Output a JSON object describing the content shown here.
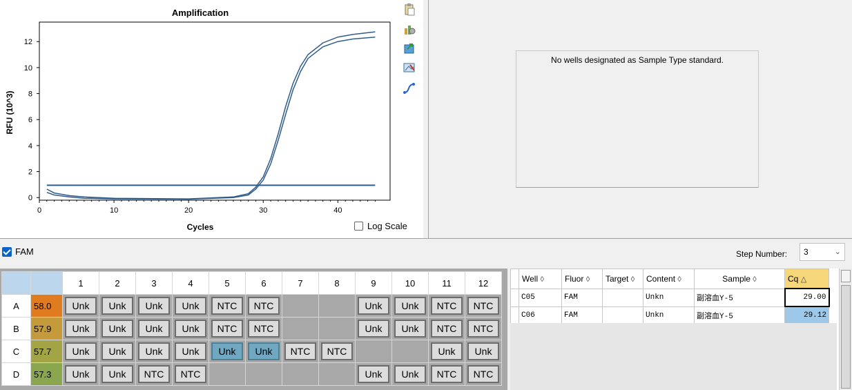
{
  "chart_data": {
    "type": "line",
    "title": "Amplification",
    "xlabel": "Cycles",
    "ylabel": "RFU (10^3)",
    "xlim": [
      0,
      47
    ],
    "ylim": [
      -0.2,
      13.5
    ],
    "xticks": [
      0,
      10,
      20,
      30,
      40
    ],
    "yticks": [
      0,
      2,
      4,
      6,
      8,
      10,
      12
    ],
    "grid": true,
    "threshold": 0.95,
    "series": [
      {
        "values": [
          [
            1,
            0.65
          ],
          [
            2,
            0.35
          ],
          [
            4,
            0.15
          ],
          [
            6,
            0.05
          ],
          [
            10,
            -0.05
          ],
          [
            20,
            -0.1
          ],
          [
            26,
            0.05
          ],
          [
            28,
            0.3
          ],
          [
            29,
            0.8
          ],
          [
            30,
            1.6
          ],
          [
            31,
            3.0
          ],
          [
            32,
            4.9
          ],
          [
            33,
            7.0
          ],
          [
            34,
            8.8
          ],
          [
            35,
            10.1
          ],
          [
            36,
            11.0
          ],
          [
            38,
            11.9
          ],
          [
            40,
            12.35
          ],
          [
            42,
            12.55
          ],
          [
            45,
            12.75
          ]
        ]
      },
      {
        "values": [
          [
            1,
            0.4
          ],
          [
            2,
            0.2
          ],
          [
            4,
            0.05
          ],
          [
            6,
            -0.05
          ],
          [
            10,
            -0.1
          ],
          [
            20,
            -0.12
          ],
          [
            26,
            0.0
          ],
          [
            28,
            0.2
          ],
          [
            29,
            0.65
          ],
          [
            30,
            1.35
          ],
          [
            31,
            2.6
          ],
          [
            32,
            4.4
          ],
          [
            33,
            6.4
          ],
          [
            34,
            8.3
          ],
          [
            35,
            9.7
          ],
          [
            36,
            10.7
          ],
          [
            38,
            11.6
          ],
          [
            40,
            12.0
          ],
          [
            42,
            12.2
          ],
          [
            45,
            12.35
          ]
        ]
      }
    ]
  },
  "chart_panel": {
    "log_scale_label": "Log Scale",
    "icons": [
      "clipboard-icon",
      "chart-settings-icon",
      "export-icon",
      "image-icon",
      "curve-icon"
    ]
  },
  "standard_panel": {
    "message": "No wells designated as Sample Type standard."
  },
  "fluor_filter": {
    "label": "FAM",
    "checked": true
  },
  "step": {
    "label": "Step Number:",
    "value": "3"
  },
  "plate": {
    "columns": [
      "1",
      "2",
      "3",
      "4",
      "5",
      "6",
      "7",
      "8",
      "9",
      "10",
      "11",
      "12"
    ],
    "rows": [
      {
        "label": "A",
        "temp": "58.0",
        "temp_color": "#e07b20",
        "wells": [
          "Unk",
          "Unk",
          "Unk",
          "Unk",
          "NTC",
          "NTC",
          "",
          "",
          "Unk",
          "Unk",
          "NTC",
          "NTC"
        ]
      },
      {
        "label": "B",
        "temp": "57.9",
        "temp_color": "#c49a3a",
        "wells": [
          "Unk",
          "Unk",
          "Unk",
          "Unk",
          "NTC",
          "NTC",
          "",
          "",
          "Unk",
          "Unk",
          "NTC",
          "NTC"
        ]
      },
      {
        "label": "C",
        "temp": "57.7",
        "temp_color": "#a3a545",
        "wells": [
          "Unk",
          "Unk",
          "Unk",
          "Unk",
          "Unk*",
          "Unk*",
          "NTC",
          "NTC",
          "",
          "",
          "Unk",
          "Unk"
        ]
      },
      {
        "label": "D",
        "temp": "57.3",
        "temp_color": "#8aa64e",
        "wells": [
          "Unk",
          "Unk",
          "NTC",
          "NTC",
          "",
          "",
          "",
          "",
          "Unk",
          "Unk",
          "NTC",
          "NTC"
        ]
      }
    ]
  },
  "results": {
    "headers": [
      "Well",
      "Fluor",
      "Target",
      "Content",
      "Sample",
      "Cq"
    ],
    "rows": [
      {
        "well": "C05",
        "fluor": "FAM",
        "target": "",
        "content": "Unkn",
        "sample": "副溶血Y-5",
        "cq": "29.00"
      },
      {
        "well": "C06",
        "fluor": "FAM",
        "target": "",
        "content": "Unkn",
        "sample": "副溶血Y-5",
        "cq": "29.12"
      }
    ]
  },
  "colors": {
    "curve": "#2f5c8a",
    "selected_well": "#6fa8c0",
    "accent": "#0a64c8"
  }
}
